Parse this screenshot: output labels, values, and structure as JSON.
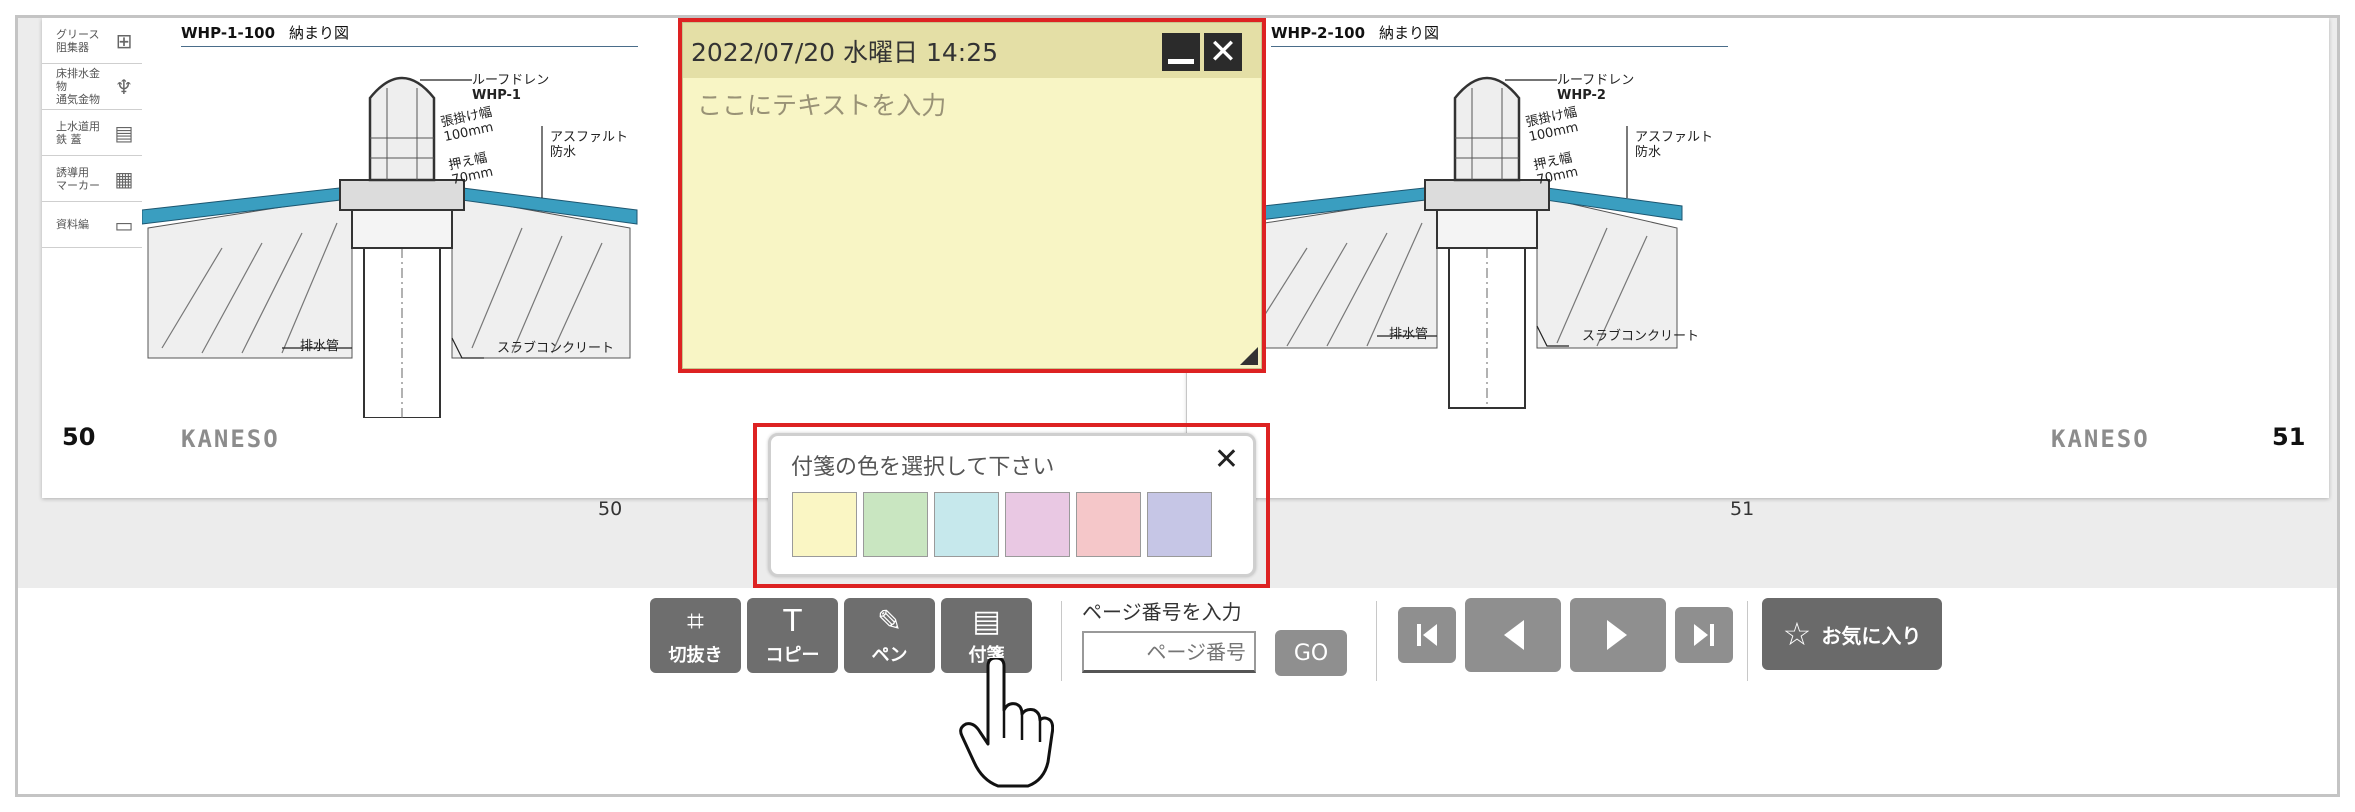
{
  "viewer": {
    "left_page": {
      "drawing_code": "WHP-1-100",
      "drawing_sub": "納まり図",
      "page_number": "50",
      "brand": "KANESO",
      "categories": [
        {
          "label": "グリース\n阻集器",
          "icon": "grease-trap-icon",
          "glyph": "⊞"
        },
        {
          "label": "床排水金物\n通気金物",
          "icon": "floor-drain-icon",
          "glyph": "♆"
        },
        {
          "label": "上水道用\n鉄 蓋",
          "icon": "manhole-cover-icon",
          "glyph": "▤"
        },
        {
          "label": "誘導用\nマーカー",
          "icon": "marker-icon",
          "glyph": "▦"
        },
        {
          "label": "資料編",
          "icon": "book-icon",
          "glyph": "▭"
        }
      ],
      "labels": {
        "roof_drain": "ルーフドレン",
        "model": "WHP-1",
        "pull_width": "張掛け幅",
        "pull_width_val": "100mm",
        "press_width": "押え幅",
        "press_width_val": "70mm",
        "asphalt": "アスファルト",
        "waterproof": "防水",
        "drain_pipe": "排水管",
        "slab": "スラブコンクリート"
      }
    },
    "right_page": {
      "drawing_code": "WHP-2-100",
      "drawing_sub": "納まり図",
      "page_number": "51",
      "brand": "KANESO",
      "labels": {
        "roof_drain": "ルーフドレン",
        "model": "WHP-2",
        "pull_width": "張掛け幅",
        "pull_width_val": "100mm",
        "press_width": "押え幅",
        "press_width_val": "70mm",
        "asphalt": "アスファルト",
        "waterproof": "防水",
        "drain_pipe": "排水管",
        "slab": "スラブコンクリート"
      }
    },
    "below_left_number": "50",
    "below_right_number": "51"
  },
  "sticky_note": {
    "datetime": "2022/07/20 水曜日 14:25",
    "placeholder": "ここにテキストを入力",
    "background_color": "#f8f5c5"
  },
  "color_picker": {
    "title": "付箋の色を選択して下さい",
    "close_glyph": "✕",
    "colors": [
      "#faf6c4",
      "#c9e6c1",
      "#c6e8ec",
      "#e9c8e3",
      "#f5c7c9",
      "#c6c6e6"
    ]
  },
  "toolbar": {
    "crop_label": "切抜き",
    "copy_label": "コピー",
    "pen_label": "ペン",
    "sticky_label": "付箋",
    "page_input_label": "ページ番号を入力",
    "page_input_placeholder": "ページ番号",
    "go_label": "GO",
    "favorite_label": "お気に入り",
    "favorite_icon": "star-icon"
  },
  "accent_colors": {
    "highlight": "#dd2222",
    "button_dark": "#6e6e6e",
    "button_light": "#8f8f8f",
    "roof_membrane": "#3a9ec0"
  }
}
